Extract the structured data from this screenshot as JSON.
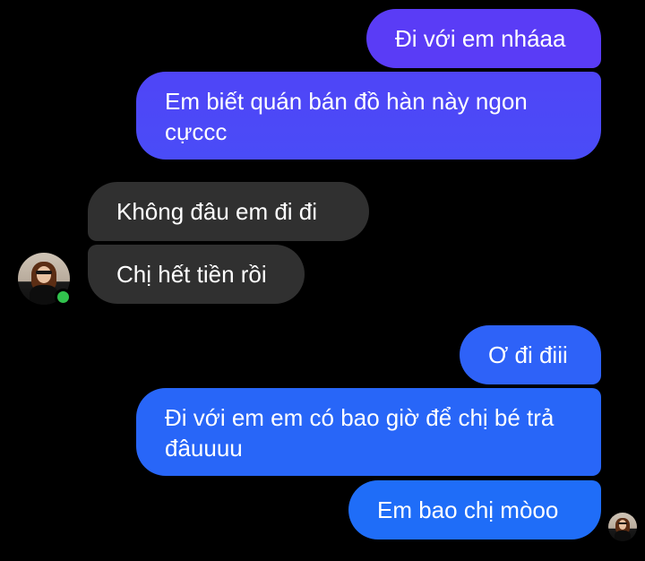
{
  "colors": {
    "background": "#000000",
    "incoming_bubble": "#303030",
    "outgoing_gradient_top": "#5a3cf6",
    "outgoing_gradient_bottom": "#1f6df8",
    "online_indicator": "#31c24d",
    "text": "#ffffff"
  },
  "contact": {
    "avatar_icon": "contact-avatar-icon",
    "online": true
  },
  "messages": [
    {
      "id": "m1",
      "direction": "outgoing",
      "text": "Đi với em nháaa"
    },
    {
      "id": "m2",
      "direction": "outgoing",
      "text": "Em biết quán bán đồ hàn này ngon cựccc"
    },
    {
      "id": "m3",
      "direction": "incoming",
      "text": "Không đâu em đi đi"
    },
    {
      "id": "m4",
      "direction": "incoming",
      "text": "Chị hết tiền rồi"
    },
    {
      "id": "m5",
      "direction": "outgoing",
      "text": "Ơ đi điii"
    },
    {
      "id": "m6",
      "direction": "outgoing",
      "text": "Đi với em em có bao giờ để chị bé trả đâuuuu"
    },
    {
      "id": "m7",
      "direction": "outgoing",
      "text": "Em bao chị mòoo"
    }
  ],
  "read_receipt": {
    "avatar_icon": "seen-avatar-icon"
  }
}
